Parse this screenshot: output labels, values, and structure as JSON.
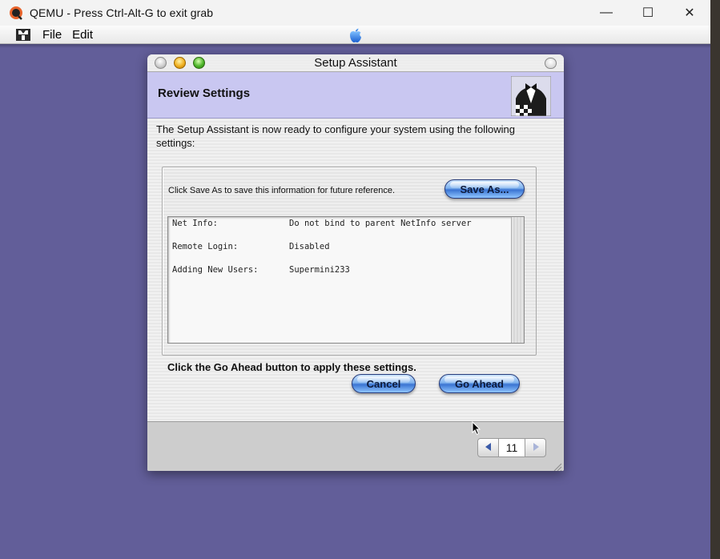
{
  "host": {
    "title": "QEMU - Press Ctrl-Alt-G to exit grab",
    "controls": {
      "minimize": "—",
      "maximize": "☐",
      "close": "✕"
    }
  },
  "menubar": {
    "items": [
      "File",
      "Edit"
    ]
  },
  "window": {
    "title": "Setup Assistant",
    "header_title": "Review Settings",
    "intro": "The Setup Assistant is now ready to configure your system using the following settings:",
    "save_note": "Click Save As to save this information for future reference.",
    "save_as_label": "Save As...",
    "settings": [
      {
        "key": "Net Info:",
        "value": "Do not bind to parent NetInfo server"
      },
      {
        "key": "Remote Login:",
        "value": "Disabled"
      },
      {
        "key": "Adding New Users:",
        "value": "Supermini233"
      }
    ],
    "apply_note": "Click the Go Ahead button to apply these settings.",
    "cancel_label": "Cancel",
    "go_ahead_label": "Go Ahead",
    "page_number": "11"
  },
  "colors": {
    "desktop": "#625e99",
    "header_band": "#c9c7f1",
    "aqua_blue": "#3a74d2"
  }
}
